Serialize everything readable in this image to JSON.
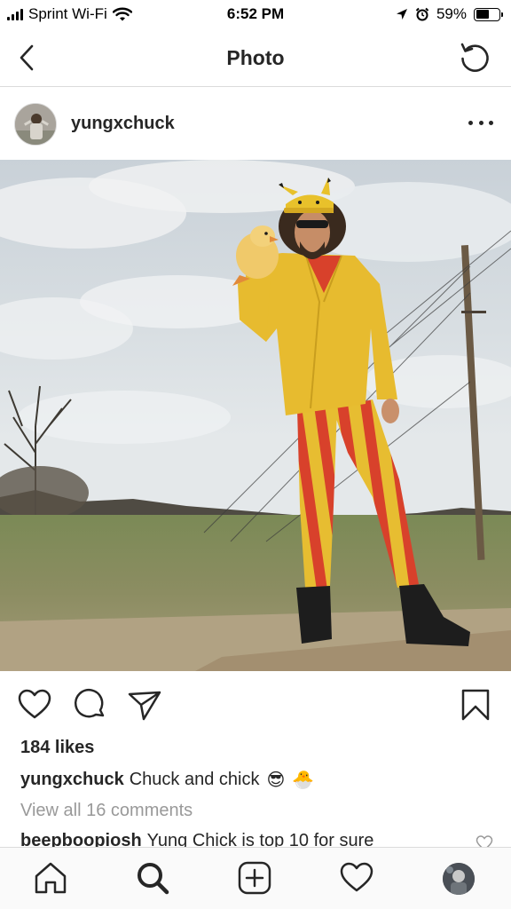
{
  "status_bar": {
    "carrier": "Sprint Wi-Fi",
    "time": "6:52 PM",
    "battery": "59%",
    "battery_level": 0.59,
    "icons": [
      "signal-icon",
      "wifi-icon",
      "location-icon",
      "alarm-icon",
      "battery-icon"
    ]
  },
  "header": {
    "title": "Photo",
    "back_icon": "chevron-left-icon",
    "refresh_icon": "refresh-icon"
  },
  "post": {
    "username": "yungxchuck",
    "more_icon": "more-dots-icon",
    "likes": "184 likes",
    "caption": {
      "username": "yungxchuck",
      "text": "Chuck and chick",
      "emojis": [
        "😎",
        "🐣"
      ]
    },
    "view_comments": "View all 16 comments",
    "comment": {
      "username": "beepboopiosh",
      "text": "Yung Chick is top 10 for sure"
    }
  },
  "actions": [
    "heart-icon",
    "comment-icon",
    "share-icon",
    "bookmark-icon"
  ],
  "tab_bar": [
    "home-icon",
    "search-icon",
    "add-post-icon",
    "activity-heart-icon",
    "profile-avatar"
  ],
  "colors": {
    "text": "#262626",
    "muted": "#999999",
    "border": "#dbdbdb",
    "jacket_yellow": "#e8bd2c",
    "stripe_red": "#d9412a"
  }
}
